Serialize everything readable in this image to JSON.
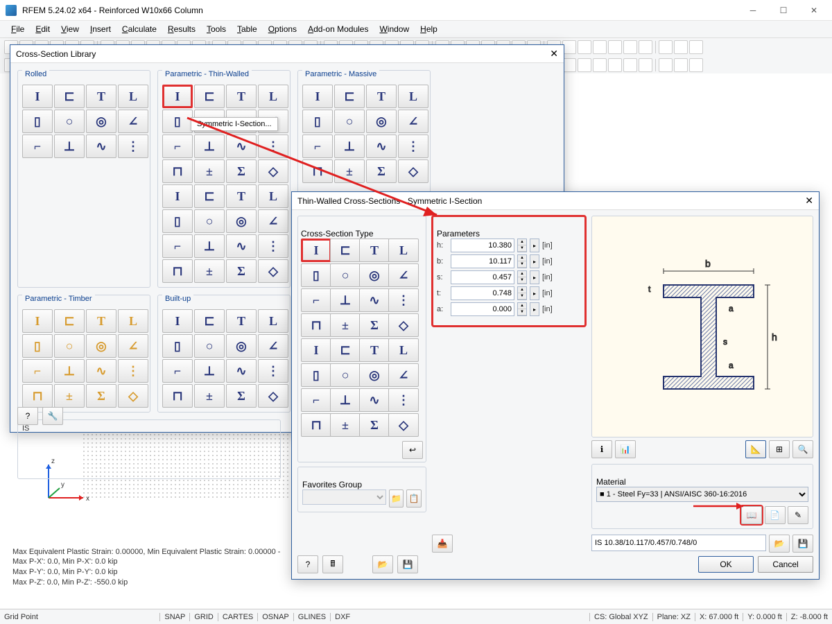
{
  "title": "RFEM 5.24.02 x64 - Reinforced W10x66 Column",
  "menus": [
    "File",
    "Edit",
    "View",
    "Insert",
    "Calculate",
    "Results",
    "Tools",
    "Table",
    "Options",
    "Add-on Modules",
    "Window",
    "Help"
  ],
  "lib": {
    "title": "Cross-Section Library",
    "groups": {
      "rolled": "Rolled",
      "paramThin": "Parametric - Thin-Walled",
      "paramMassive": "Parametric - Massive",
      "paramTimber": "Parametric - Timber",
      "builtup": "Built-up"
    },
    "selected_tooltip": "Symmetric I-Section...",
    "info": "IS"
  },
  "param": {
    "title": "Thin-Walled Cross-Sections - Symmetric I-Section",
    "cstLabel": "Cross-Section Type",
    "paramsLabel": "Parameters",
    "rows": [
      {
        "k": "h:",
        "v": "10.380",
        "u": "[in]"
      },
      {
        "k": "b:",
        "v": "10.117",
        "u": "[in]"
      },
      {
        "k": "s:",
        "v": "0.457",
        "u": "[in]"
      },
      {
        "k": "t:",
        "v": "0.748",
        "u": "[in]"
      },
      {
        "k": "a:",
        "v": "0.000",
        "u": "[in]"
      }
    ],
    "favLabel": "Favorites Group",
    "matLabel": "Material",
    "material": "■ 1 - Steel Fy=33 | ANSI/AISC 360-16:2016",
    "designation": "IS 10.38/10.117/0.457/0.748/0",
    "ok": "OK",
    "cancel": "Cancel"
  },
  "status": {
    "left": "Grid Point",
    "modes": [
      "SNAP",
      "GRID",
      "CARTES",
      "OSNAP",
      "GLINES",
      "DXF"
    ],
    "cs": "CS: Global XYZ",
    "plane": "Plane: XZ",
    "x": "X: 67.000 ft",
    "y": "Y: 0.000 ft",
    "z": "Z: -8.000 ft"
  },
  "output": [
    "Max Equivalent Plastic Strain: 0.00000, Min Equivalent Plastic Strain: 0.00000 -",
    "Max P-X': 0.0, Min P-X': 0.0 kip",
    "Max P-Y': 0.0, Min P-Y': 0.0 kip",
    "Max P-Z': 0.0, Min P-Z': -550.0 kip"
  ]
}
